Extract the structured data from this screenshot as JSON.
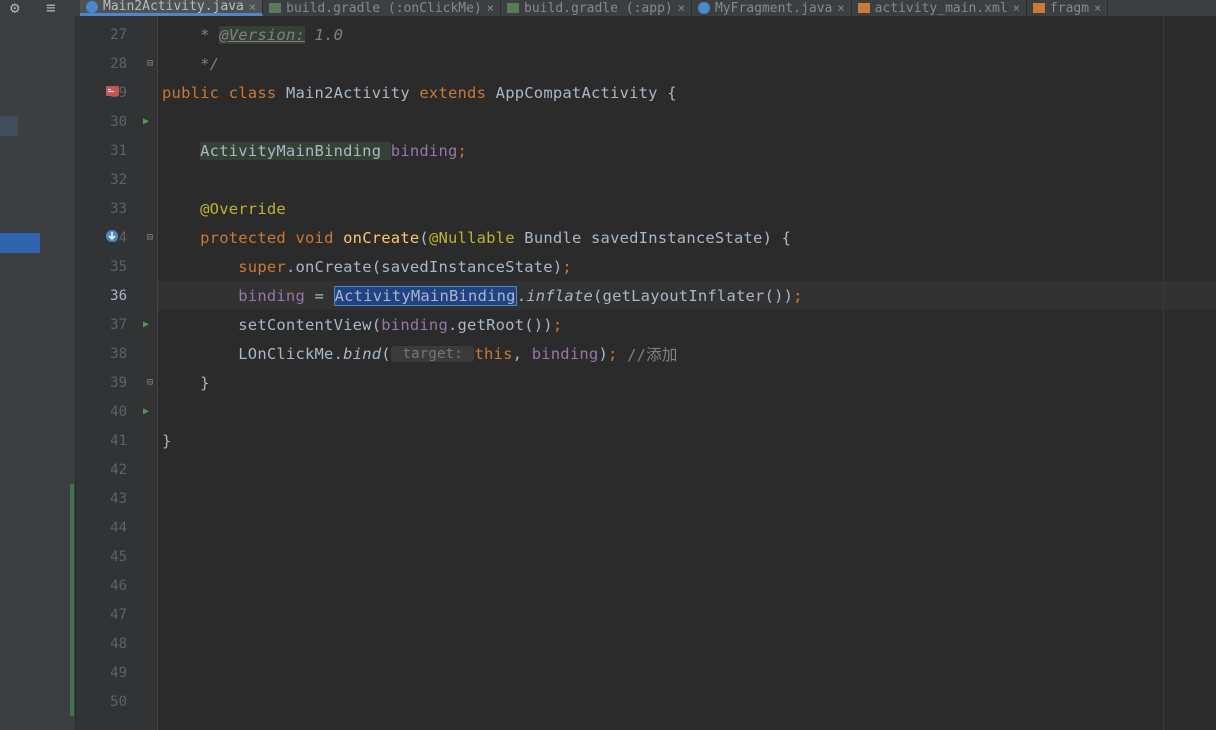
{
  "tabs": [
    {
      "label": "Main2Activity.java",
      "type": "java",
      "active": true
    },
    {
      "label": "build.gradle (:onClickMe)",
      "type": "gradle",
      "active": false
    },
    {
      "label": "build.gradle (:app)",
      "type": "gradle",
      "active": false
    },
    {
      "label": "MyFragment.java",
      "type": "java",
      "active": false
    },
    {
      "label": "activity_main.xml",
      "type": "xml",
      "active": false
    },
    {
      "label": "fragm",
      "type": "xml",
      "active": false
    }
  ],
  "gutter": {
    "start": 27,
    "end": 50,
    "current": 36
  },
  "code": {
    "l27": {
      "indent": "    ",
      "comment_prefix": "* ",
      "annotation": "@Version:",
      "version": " 1.0"
    },
    "l28": {
      "indent": "    ",
      "comment": "*/"
    },
    "l29": {
      "kw1": "public ",
      "kw2": "class ",
      "name": "Main2Activity ",
      "kw3": "extends ",
      "base": "AppCompatActivity {"
    },
    "l31": {
      "indent": "    ",
      "type": "ActivityMainBinding ",
      "field": "binding",
      "semi": ";"
    },
    "l33": {
      "indent": "    ",
      "ann": "@Override"
    },
    "l34": {
      "indent": "    ",
      "kw1": "protected ",
      "kw2": "void ",
      "name": "onCreate",
      "open": "(",
      "ann": "@Nullable ",
      "ptype": "Bundle ",
      "pname": "savedInstanceState",
      "close": ") {"
    },
    "l35": {
      "indent": "        ",
      "kw": "super",
      "dot": ".onCreate(savedInstanceState)",
      "semi": ";"
    },
    "l36": {
      "indent": "        ",
      "field": "binding",
      "eq": " = ",
      "hl": "ActivityMainBinding",
      "dot": ".",
      "static": "inflate",
      "call": "(getLayoutInflater())",
      "semi": ";"
    },
    "l37": {
      "indent": "        ",
      "call1": "setContentView(",
      "field": "binding",
      "call2": ".getRoot())",
      "semi": ";"
    },
    "l38": {
      "indent": "        ",
      "cls": "LOnClickMe.",
      "static": "bind",
      "open": "(",
      "hint": " target: ",
      "kw": "this",
      "mid": ", ",
      "field": "binding",
      "close": ")",
      "semi": ";",
      "space": " ",
      "comment": "//添加"
    },
    "l39": {
      "indent": "    ",
      "brace": "}"
    },
    "l41": {
      "brace": "}"
    }
  }
}
